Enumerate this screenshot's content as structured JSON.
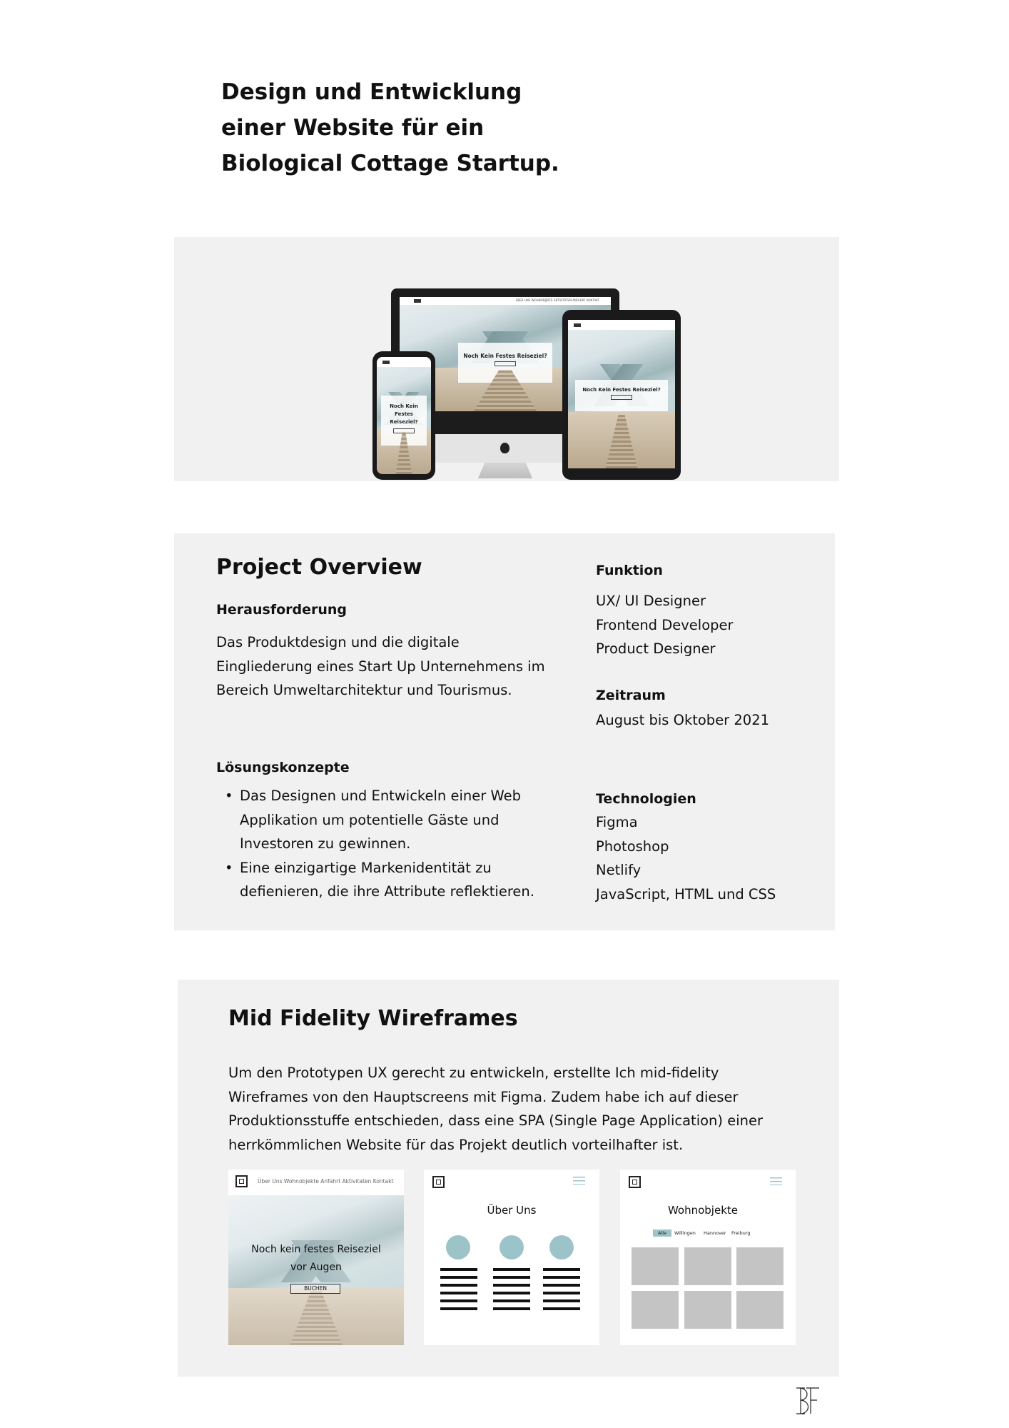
{
  "headline": {
    "lines": [
      "Design und Entwicklung",
      "einer Website für ein",
      "Biological Cottage Startup."
    ]
  },
  "hero": {
    "desktop_cta": "Noch Kein Festes Reiseziel?",
    "tablet_cta": "Noch Kein Festes Reiseziel?",
    "phone_cta_lines": [
      "Noch Kein",
      "Festes",
      "Reiseziel?"
    ],
    "desktop_nav": "ÜBER UNS   WOHNOBJEKTE   AKTIVITÄTEN   ANFAHRT   KONTAKT"
  },
  "overview": {
    "title": "Project Overview",
    "challenge": {
      "heading": "Herausforderung",
      "lines": [
        "Das Produktdesign und die digitale",
        "Eingliederung eines Start Up Unternehmens im",
        "Bereich Umweltarchitektur und Tourismus."
      ]
    },
    "solutions": {
      "heading": "Lösungskonzepte",
      "items": [
        [
          "Das Designen und Entwickeln einer Web",
          "Applikation um potentielle Gäste und",
          "Investoren zu gewinnen."
        ],
        [
          "Eine einzigartige Markenidentität zu",
          "defienieren, die ihre Attribute reflektieren."
        ]
      ]
    },
    "function": {
      "heading": "Funktion",
      "items": [
        "UX/ UI Designer",
        "Frontend Developer",
        "Product Designer"
      ]
    },
    "period": {
      "heading": "Zeitraum",
      "value": "August bis Oktober 2021"
    },
    "tech": {
      "heading": "Technologien",
      "items": [
        "Figma",
        "Photoshop",
        "Netlify",
        "JavaScript, HTML und CSS"
      ]
    }
  },
  "wireframes": {
    "title": "Mid Fidelity Wireframes",
    "lines": [
      "Um den Prototypen UX gerecht zu entwickeln, erstellte Ich mid-fidelity",
      "Wireframes von den Hauptscreens mit Figma. Zudem habe ich auf dieser",
      "Produktionsstuffe entschieden, dass eine SPA (Single Page Application) einer",
      "herrkömmlichen Website für das Projekt deutlich vorteilhafter ist."
    ],
    "card1": {
      "nav": "Über Uns   Wohnobjekte   Anfahrt   Aktivitaten   Kontakt",
      "hero_lines": [
        "Noch kein festes Reiseziel",
        "vor Augen"
      ],
      "button": "BUCHEN"
    },
    "card2": {
      "title": "Über Uns"
    },
    "card3": {
      "title": "Wohnobjekte",
      "filters": [
        "Alle",
        "Willingen",
        "Hannover",
        "Freiburg"
      ]
    }
  },
  "footer": {
    "brand_icon": "bf-monogram-icon"
  },
  "colors": {
    "panel": "#f1f1f1",
    "accent": "#9cc3c7",
    "placeholder": "#c4c4c4"
  }
}
